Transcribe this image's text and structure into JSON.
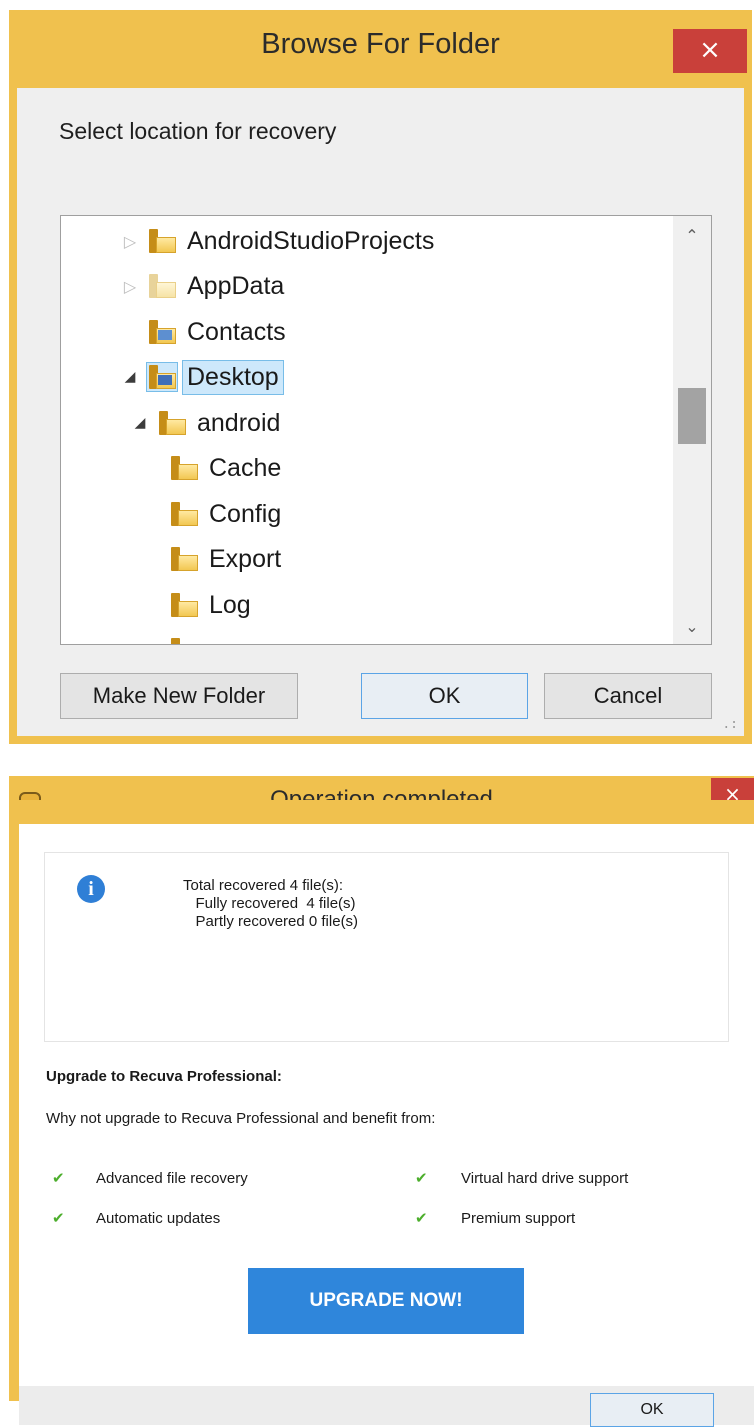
{
  "browse_dialog": {
    "title": "Browse For Folder",
    "close_glyph": "×",
    "prompt": "Select location for recovery",
    "tree": [
      {
        "label": "AndroidStudioProjects",
        "state": "collapsed",
        "icon": "folder-icon",
        "selected": false
      },
      {
        "label": "AppData",
        "state": "collapsed",
        "icon": "folder-icon",
        "selected": false
      },
      {
        "label": "Contacts",
        "state": "leaf",
        "icon": "contacts-folder-icon",
        "selected": false
      },
      {
        "label": "Desktop",
        "state": "expanded",
        "icon": "desktop-folder-icon",
        "selected": true
      },
      {
        "label": "android",
        "state": "expanded",
        "icon": "folder-icon",
        "selected": false
      },
      {
        "label": "Cache",
        "state": "leaf",
        "icon": "folder-icon",
        "selected": false
      },
      {
        "label": "Config",
        "state": "leaf",
        "icon": "folder-icon",
        "selected": false
      },
      {
        "label": "Export",
        "state": "leaf",
        "icon": "folder-icon",
        "selected": false
      },
      {
        "label": "Log",
        "state": "leaf",
        "icon": "folder-icon",
        "selected": false
      }
    ],
    "buttons": {
      "make_new_folder": "Make New Folder",
      "ok": "OK",
      "cancel": "Cancel"
    },
    "scroll_up_glyph": "⌃",
    "scroll_down_glyph": "⌄"
  },
  "operation_dialog": {
    "title": "Operation completed",
    "close_glyph": "×",
    "summary": {
      "line1": "Total recovered 4 file(s):",
      "line2": "   Fully recovered  4 file(s)",
      "line3": "   Partly recovered 0 file(s)"
    },
    "upgrade_heading": "Upgrade to Recuva Professional:",
    "upgrade_intro": "Why not upgrade to Recuva Professional and benefit from:",
    "features": [
      "Advanced file recovery",
      "Virtual hard drive support",
      "Automatic updates",
      "Premium support"
    ],
    "upgrade_button": "UPGRADE NOW!",
    "ok": "OK"
  },
  "colors": {
    "window_frame": "#f0c14e",
    "close_button": "#c9403a",
    "upgrade_button": "#2f86db",
    "check_green": "#4cae2c",
    "info_blue": "#2f7fd6",
    "selection_blue": "#cde8fb"
  }
}
